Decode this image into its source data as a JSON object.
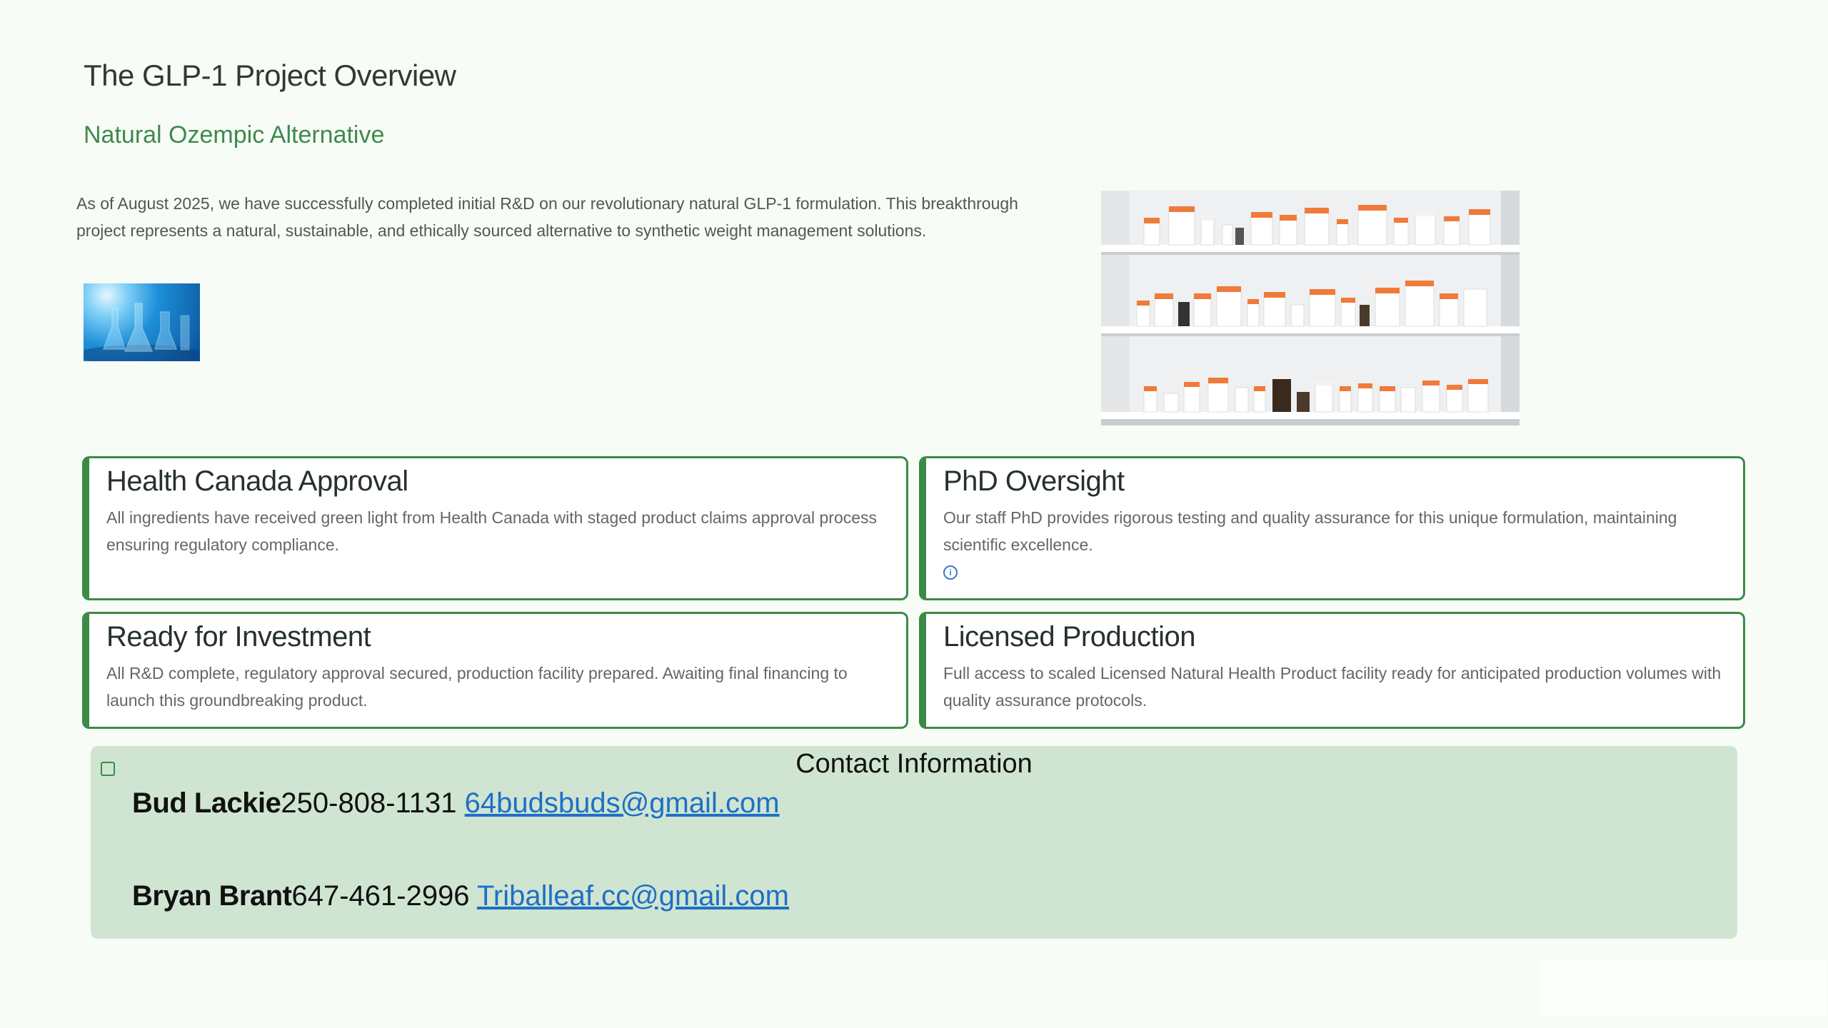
{
  "header": {
    "title": "The GLP-1 Project Overview",
    "subtitle": "Natural Ozempic Alternative"
  },
  "intro": {
    "text": "As of August 2025, we have successfully completed initial R&D on our revolutionary natural GLP-1 formulation. This breakthrough project represents a natural, sustainable, and ethically sourced alternative to synthetic weight management solutions."
  },
  "cards": [
    {
      "title": "Health Canada Approval",
      "body": "All ingredients have received green light from Health Canada with staged product claims approval process ensuring regulatory compliance."
    },
    {
      "title": "PhD Oversight",
      "body": "Our staff PhD provides rigorous testing and quality assurance for this unique formulation, maintaining scientific excellence.",
      "icon": "info-icon"
    },
    {
      "title": "Ready for Investment",
      "body": "All R&D complete, regulatory approval secured, production facility prepared. Awaiting final financing to launch this groundbreaking product."
    },
    {
      "title": "Licensed Production",
      "body": "Full access to scaled Licensed Natural Health Product facility ready for anticipated production volumes with quality assurance protocols."
    }
  ],
  "contact": {
    "title": "Contact Information",
    "people": [
      {
        "name": "Bud Lackie",
        "phone": "250-808-1131",
        "email": "64budsbuds@gmail.com"
      },
      {
        "name": "Bryan Brant",
        "phone": "647-461-2996",
        "email": "Triballeaf.cc@gmail.com"
      }
    ]
  },
  "colors": {
    "accent": "#3c8a47",
    "subtitle": "#3f8a4c",
    "contact_bg": "#cfe5d1",
    "link": "#1f6fc6",
    "page_bg": "#f7fcf6"
  },
  "images": {
    "lab": "lab-glassware-image",
    "shelves": "pharmacy-shelves-image"
  }
}
